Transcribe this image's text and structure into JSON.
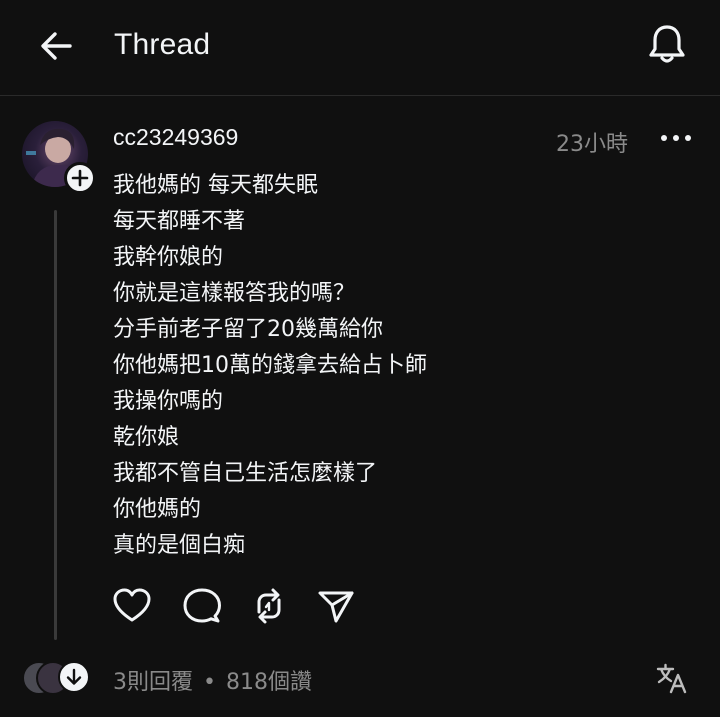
{
  "header": {
    "title": "Thread",
    "back_icon": "arrow-left-icon",
    "bell_icon": "bell-icon"
  },
  "post": {
    "username": "cc23249369",
    "timestamp": "23小時",
    "lines": [
      "我他媽的 每天都失眠",
      "每天都睡不著",
      "我幹你娘的",
      "你就是這樣報答我的嗎？",
      "分手前老子留了20幾萬給你",
      "你他媽把10萬的錢拿去給占卜師",
      "我操你嗎的",
      "乾你娘",
      "我都不管自己生活怎麼樣了",
      "你他媽的",
      "真的是個白痴"
    ],
    "actions": [
      "heart-icon",
      "comment-icon",
      "repost-icon",
      "share-icon"
    ]
  },
  "footer": {
    "replies": "3則回覆",
    "separator": "•",
    "likes": "818個讚",
    "translate_icon": "translate-icon"
  },
  "colors": {
    "background": "#101010",
    "text": "#f3f5f7",
    "muted": "#8a8a8a",
    "divider": "#2a2a2a"
  }
}
